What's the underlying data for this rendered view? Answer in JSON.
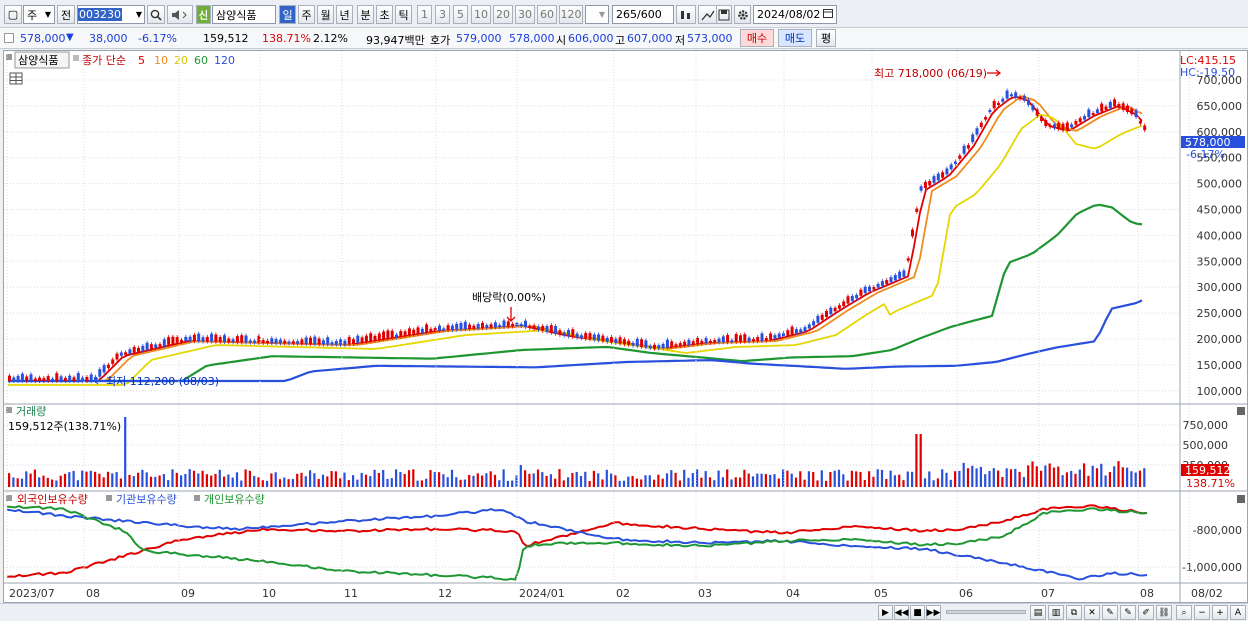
{
  "toolbar": {
    "market": "주",
    "prev_label": "전",
    "code": "003230",
    "name": "삼양식품",
    "shin_label": "신",
    "periods": [
      "일",
      "주",
      "월",
      "년",
      "분",
      "초",
      "틱"
    ],
    "minute_steps": [
      "1",
      "3",
      "5",
      "10",
      "20",
      "30",
      "60",
      "120"
    ],
    "count": "265",
    "count_total": "/600",
    "date": "2024/08/02"
  },
  "info": {
    "price": "578,000",
    "arrow": "▼",
    "change": "38,000",
    "change_pct": "-6.17%",
    "volume": "159,512",
    "volume_ratio": "138.71%",
    "turnover": "2.12%",
    "amount": "93,947백만",
    "ask_label": "호가",
    "ask": "579,000",
    "bid": "578,000",
    "open_label": "시",
    "open": "606,000",
    "high_label": "고",
    "high": "607,000",
    "low_label": "저",
    "low": "573,000",
    "buy_label": "매수",
    "sell_label": "매도",
    "eval_label": "평"
  },
  "price_panel": {
    "stock_label": "삼양식품",
    "ma_title": "종가 단순",
    "ma_periods": [
      "5",
      "10",
      "20",
      "60",
      "120"
    ],
    "ma_colors": [
      "#e00000",
      "#ee8c1e",
      "#e6d600",
      "#1e9632",
      "#2850dc"
    ],
    "lc": "LC:415.15",
    "hc": "HC:-19.50",
    "y_ticks": [
      "700,000",
      "650,000",
      "600,000",
      "550,000",
      "500,000",
      "450,000",
      "400,000",
      "350,000",
      "300,000",
      "250,000",
      "200,000",
      "150,000",
      "100,000"
    ],
    "current_price": "578,000",
    "current_pct": "-6.17%",
    "high_annotation": "최고 718,000 (06/19)",
    "low_annotation": "최저 112,200 (08/03)",
    "dividend_annotation": "배당락(0.00%)"
  },
  "volume_panel": {
    "title": "거래량",
    "summary": "159,512주(138.71%)",
    "y_ticks": [
      "750,000",
      "500,000",
      "250,000"
    ],
    "current": "159,512",
    "current_pct": "138.71%"
  },
  "holdings_panel": {
    "legend": [
      "외국인보유수량",
      "기관보유수량",
      "개인보유수량"
    ],
    "legend_colors": [
      "#e00000",
      "#2850dc",
      "#1e9632"
    ],
    "y_ticks": [
      "-800,000",
      "-1,000,000"
    ]
  },
  "x_axis": [
    "2023/07",
    "08",
    "09",
    "10",
    "11",
    "12",
    "2024/01",
    "02",
    "03",
    "04",
    "05",
    "06",
    "07",
    "08",
    "08/02"
  ]
}
